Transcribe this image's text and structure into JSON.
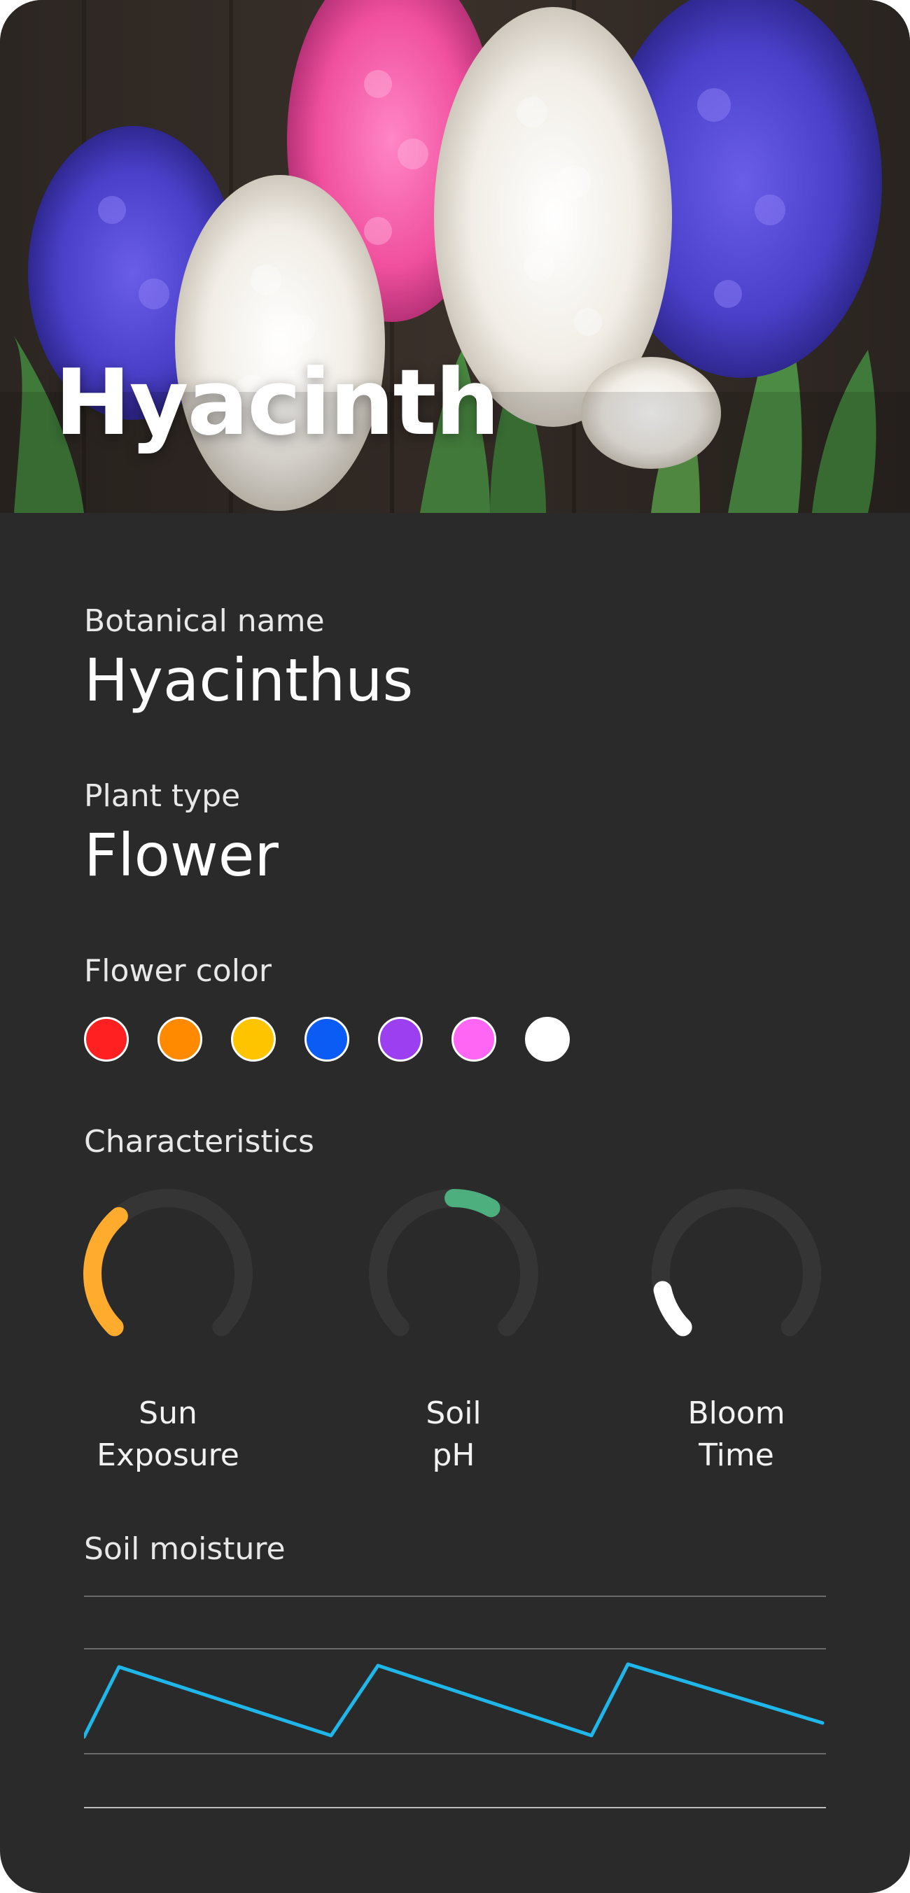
{
  "hero": {
    "title": "Hyacinth"
  },
  "botanical": {
    "label": "Botanical name",
    "value": "Hyacinthus"
  },
  "plant_type": {
    "label": "Plant type",
    "value": "Flower"
  },
  "flower_color": {
    "label": "Flower color",
    "colors": [
      "#ff2121",
      "#ff8a00",
      "#ffc400",
      "#0a5cf5",
      "#9b3ff0",
      "#ff66f4",
      "#ffffff"
    ]
  },
  "characteristics": {
    "label": "Characteristics",
    "gauges": [
      {
        "line1": "Sun",
        "line2": "Exposure",
        "level": 0.35,
        "color": "#ffab2e"
      },
      {
        "line1": "Soil",
        "line2": "pH",
        "level": 0.5,
        "color": "#4caf7d"
      },
      {
        "line1": "Bloom",
        "line2": "Time",
        "level": 0.12,
        "color": "#ffffff"
      }
    ]
  },
  "soil_moisture": {
    "label": "Soil moisture",
    "line_color": "#1fb6ea"
  }
}
